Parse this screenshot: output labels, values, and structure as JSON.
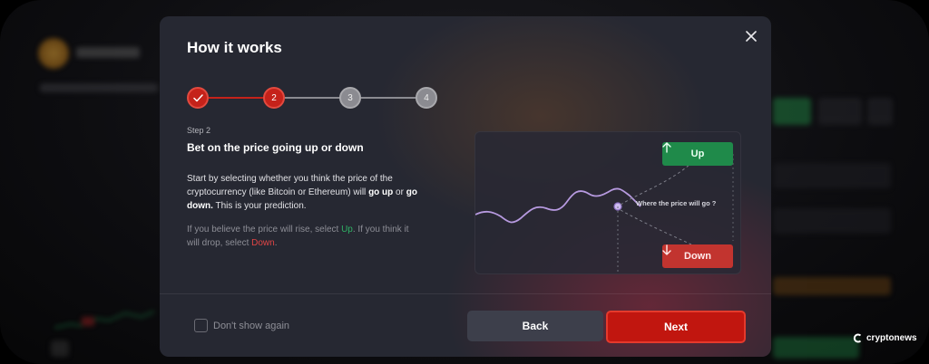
{
  "modal": {
    "title": "How it works",
    "steps": [
      {
        "label": "✓",
        "state": "done"
      },
      {
        "label": "2",
        "state": "active"
      },
      {
        "label": "3",
        "state": "pending"
      },
      {
        "label": "4",
        "state": "pending"
      }
    ],
    "step_label": "Step 2",
    "heading": "Bet on the price going up or down",
    "description": {
      "part1": "Start by selecting whether you think the price of the cryptocurrency (like Bitcoin or Ethereum) will ",
      "bold1": "go up",
      "part2": " or ",
      "bold2": "go down.",
      "part3": " This is your prediction."
    },
    "hint": {
      "part1": "If you believe the price will rise, select ",
      "up": "Up",
      "part2": ". If you think it will drop, select ",
      "down": "Down",
      "part3": "."
    },
    "illustration": {
      "up_label": "Up",
      "down_label": "Down",
      "question": "Where the price will go ?"
    },
    "dont_show_label": "Don't show again",
    "back_label": "Back",
    "next_label": "Next"
  },
  "watermark": "cryptonews",
  "colors": {
    "accent_red": "#c1160f",
    "up_green": "#1f8a4a",
    "down_red": "#c2342f",
    "line_purple": "#b79ae0"
  }
}
